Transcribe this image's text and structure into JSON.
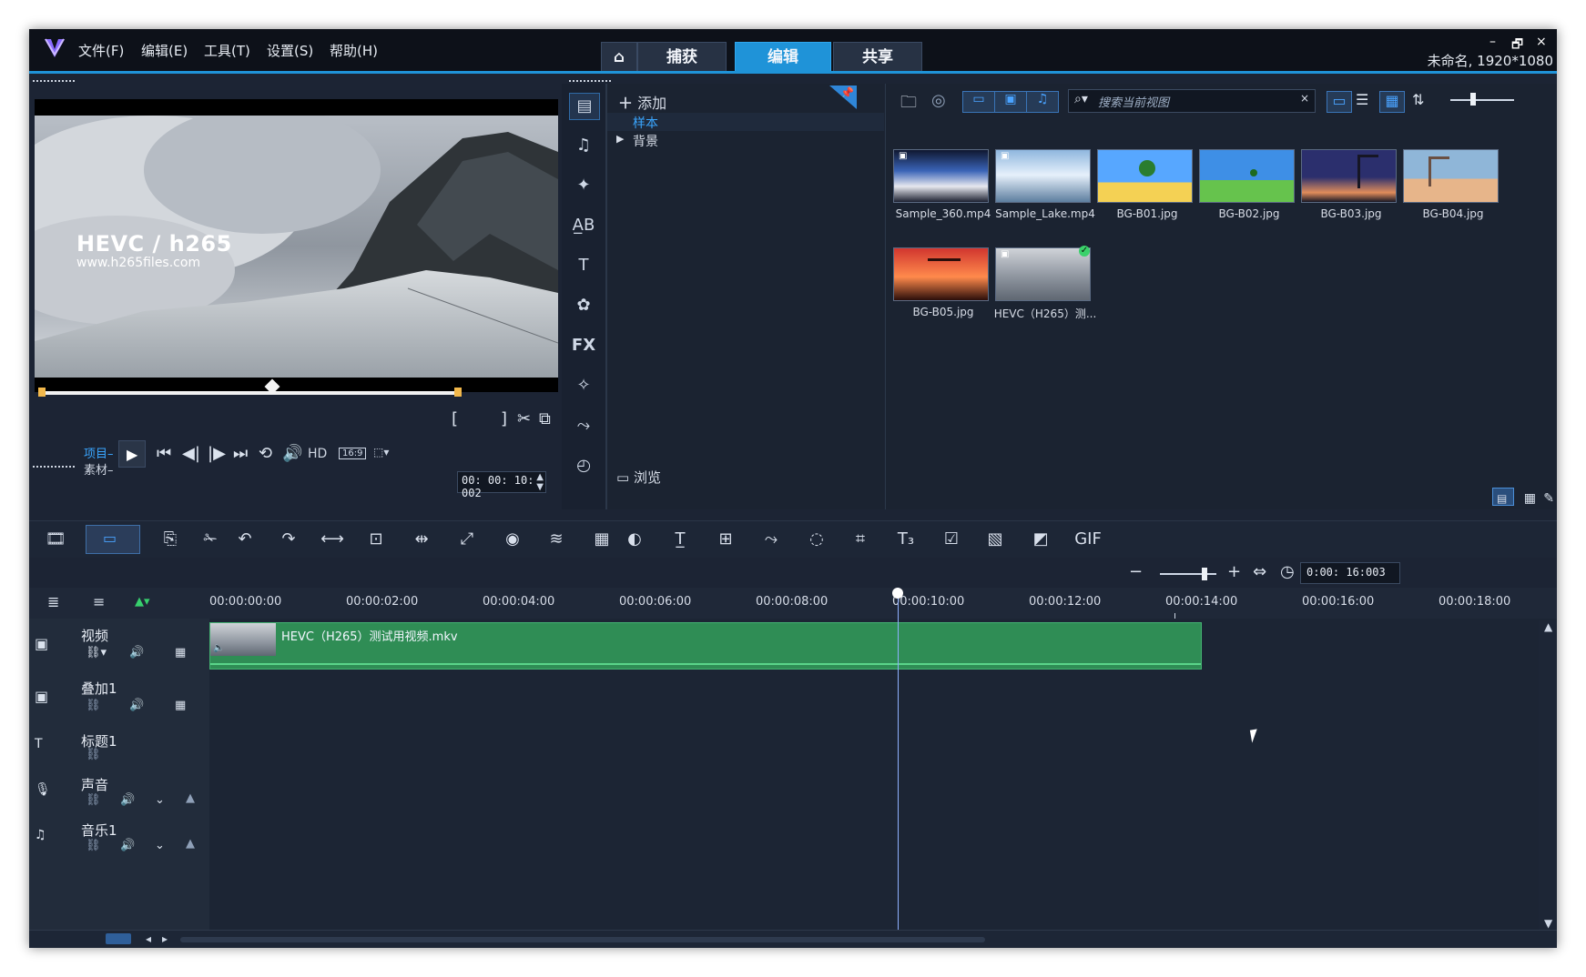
{
  "app": {
    "menu": [
      "文件(F)",
      "编辑(E)",
      "工具(T)",
      "设置(S)",
      "帮助(H)"
    ],
    "tabs": [
      "捕获",
      "编辑",
      "共享"
    ],
    "project_info": "未命名, 1920*1080",
    "window_controls": [
      "–",
      "🗗",
      "×"
    ]
  },
  "preview": {
    "overlay_title": "HEVC / h265",
    "overlay_url": "www.h265files.com",
    "mode_project": "项目",
    "mode_clip": "素材",
    "hd_label": "HD",
    "aspect_label": "16:9",
    "timecode": "00: 00: 10: 002"
  },
  "left_tools": [
    "媒体",
    "音乐",
    "转场",
    "字幕",
    "标题",
    "图形",
    "FX",
    "魔术",
    "路径",
    "速度"
  ],
  "tree": {
    "add_label": "添加",
    "items": [
      "样本",
      "背景"
    ],
    "browse_label": "浏览"
  },
  "media": {
    "search_placeholder": "搜索当前视图",
    "thumbs": [
      {
        "label": "Sample_360.mp4",
        "kind": "video",
        "colors": [
          "#3a64b7",
          "#e7e8ef",
          "#1c2030"
        ]
      },
      {
        "label": "Sample_Lake.mp4",
        "kind": "video",
        "colors": [
          "#8fb7de",
          "#e6f0fb",
          "#5d7e9f"
        ]
      },
      {
        "label": "BG-B01.jpg",
        "kind": "image",
        "colors": [
          "#57a7ff",
          "#f4d154",
          "#2a7d2f"
        ]
      },
      {
        "label": "BG-B02.jpg",
        "kind": "image",
        "colors": [
          "#3e8fe6",
          "#66c34d",
          "#1d6a1f"
        ]
      },
      {
        "label": "BG-B03.jpg",
        "kind": "image",
        "colors": [
          "#2b2f6d",
          "#e08c5b",
          "#161624"
        ]
      },
      {
        "label": "BG-B04.jpg",
        "kind": "image",
        "colors": [
          "#8fb6d8",
          "#e7b58a",
          "#6a4f42"
        ]
      },
      {
        "label": "BG-B05.jpg",
        "kind": "image",
        "colors": [
          "#d1362f",
          "#ff8a4c",
          "#2b0e0a"
        ]
      },
      {
        "label": "HEVC（H265）测...",
        "kind": "video",
        "colors": [
          "#cfd3d8",
          "#8e959f",
          "#5f6772"
        ]
      }
    ]
  },
  "timeline": {
    "timecode": "0:00: 16:003",
    "ruler": [
      "00:00:00:00",
      "00:00:02:00",
      "00:00:04:00",
      "00:00:06:00",
      "00:00:08:00",
      "00:00:10:00",
      "00:00:12:00",
      "00:00:14:00",
      "00:00:16:00",
      "00:00:18:00"
    ],
    "tracks": [
      {
        "name": "视频"
      },
      {
        "name": "叠加1"
      },
      {
        "name": "标题1"
      },
      {
        "name": "声音"
      },
      {
        "name": "音乐1"
      }
    ],
    "clip_label": "HEVC（H265）测试用视频.mkv"
  }
}
